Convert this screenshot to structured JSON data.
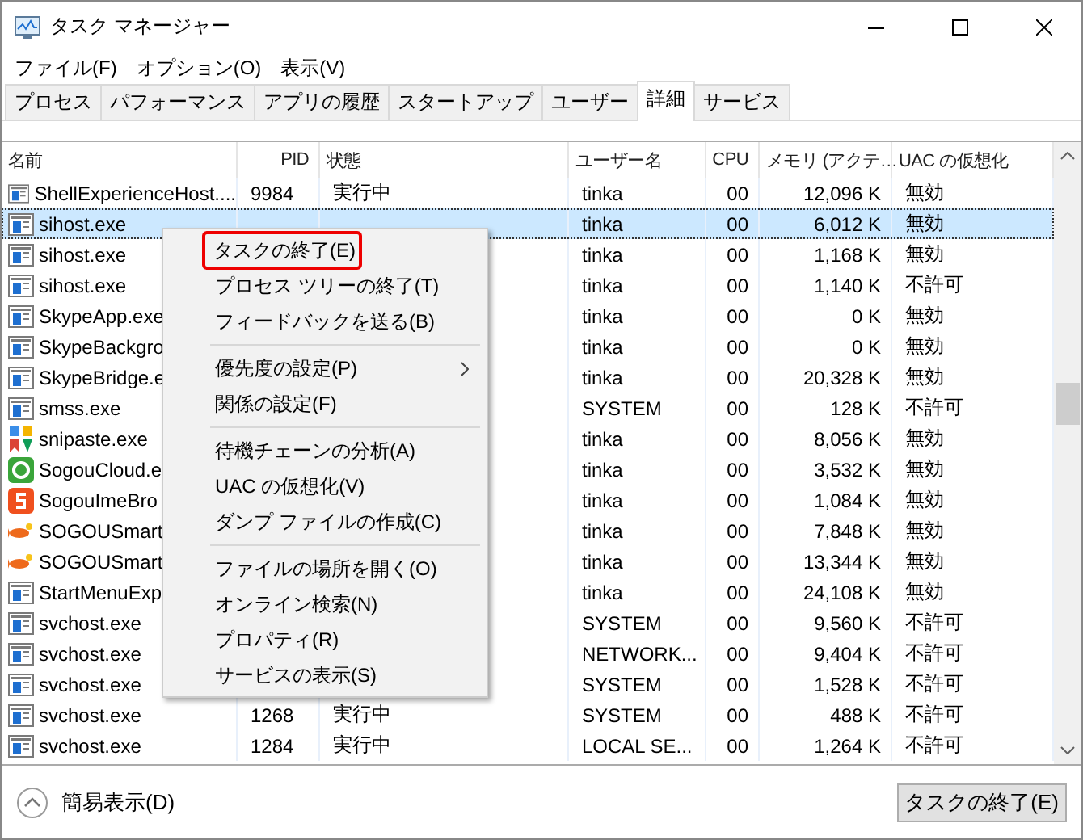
{
  "window": {
    "title": "タスク マネージャー"
  },
  "menu_bar": [
    "ファイル(F)",
    "オプション(O)",
    "表示(V)"
  ],
  "tabs": [
    {
      "label": "プロセス",
      "selected": false
    },
    {
      "label": "パフォーマンス",
      "selected": false
    },
    {
      "label": "アプリの履歴",
      "selected": false
    },
    {
      "label": "スタートアップ",
      "selected": false
    },
    {
      "label": "ユーザー",
      "selected": false
    },
    {
      "label": "詳細",
      "selected": true
    },
    {
      "label": "サービス",
      "selected": false
    }
  ],
  "table": {
    "columns": [
      "名前",
      "PID",
      "状態",
      "ユーザー名",
      "CPU",
      "メモリ (アクテ…",
      "UAC の仮想化"
    ],
    "rows": [
      {
        "kind": "window",
        "name": "ShellExperienceHost....",
        "pid": "9984",
        "status": "実行中",
        "user": "tinka",
        "cpu": "00",
        "memory": "12,096 K",
        "uac": "無効",
        "selected": false
      },
      {
        "kind": "window",
        "name": "sihost.exe",
        "user": "tinka",
        "cpu": "00",
        "memory": "6,012 K",
        "uac": "無効",
        "selected": true
      },
      {
        "kind": "window",
        "name": "sihost.exe",
        "user": "tinka",
        "cpu": "00",
        "memory": "1,168 K",
        "uac": "無効",
        "selected": false
      },
      {
        "kind": "window",
        "name": "sihost.exe",
        "user": "tinka",
        "cpu": "00",
        "memory": "1,140 K",
        "uac": "不許可",
        "selected": false
      },
      {
        "kind": "window",
        "name": "SkypeApp.exe",
        "user": "tinka",
        "cpu": "00",
        "memory": "0 K",
        "uac": "無効",
        "selected": false
      },
      {
        "kind": "window",
        "name": "SkypeBackgro",
        "user": "tinka",
        "cpu": "00",
        "memory": "0 K",
        "uac": "無効",
        "selected": false
      },
      {
        "kind": "window",
        "name": "SkypeBridge.e",
        "user": "tinka",
        "cpu": "00",
        "memory": "20,328 K",
        "uac": "無効",
        "selected": false
      },
      {
        "kind": "window",
        "name": "smss.exe",
        "user": "SYSTEM",
        "cpu": "00",
        "memory": "128 K",
        "uac": "不許可",
        "selected": false
      },
      {
        "kind": "tiles",
        "name": "snipaste.exe",
        "user": "tinka",
        "cpu": "00",
        "memory": "8,056 K",
        "uac": "無効",
        "selected": false
      },
      {
        "kind": "cloud",
        "name": "SogouCloud.e",
        "user": "tinka",
        "cpu": "00",
        "memory": "3,532 K",
        "uac": "無効",
        "selected": false
      },
      {
        "kind": "ime",
        "name": "SogouImeBro",
        "user": "tinka",
        "cpu": "00",
        "memory": "1,084 K",
        "uac": "無効",
        "selected": false
      },
      {
        "kind": "fish",
        "name": "SOGOUSmart",
        "user": "tinka",
        "cpu": "00",
        "memory": "7,848 K",
        "uac": "無効",
        "selected": false
      },
      {
        "kind": "fish",
        "name": "SOGOUSmart",
        "user": "tinka",
        "cpu": "00",
        "memory": "13,344 K",
        "uac": "無効",
        "selected": false
      },
      {
        "kind": "window",
        "name": "StartMenuExp",
        "user": "tinka",
        "cpu": "00",
        "memory": "24,108 K",
        "uac": "無効",
        "selected": false
      },
      {
        "kind": "window",
        "name": "svchost.exe",
        "user": "SYSTEM",
        "cpu": "00",
        "memory": "9,560 K",
        "uac": "不許可",
        "selected": false
      },
      {
        "kind": "window",
        "name": "svchost.exe",
        "user": "NETWORK...",
        "cpu": "00",
        "memory": "9,404 K",
        "uac": "不許可",
        "selected": false
      },
      {
        "kind": "window",
        "name": "svchost.exe",
        "user": "SYSTEM",
        "cpu": "00",
        "memory": "1,528 K",
        "uac": "不許可",
        "selected": false
      },
      {
        "kind": "window",
        "name": "svchost.exe",
        "pid": "1268",
        "status": "実行中",
        "user": "SYSTEM",
        "cpu": "00",
        "memory": "488 K",
        "uac": "不許可",
        "selected": false
      },
      {
        "kind": "window",
        "name": "svchost.exe",
        "pid": "1284",
        "status": "実行中",
        "user": "LOCAL SE...",
        "cpu": "00",
        "memory": "1,264 K",
        "uac": "不許可",
        "selected": false
      }
    ]
  },
  "context_menu": [
    {
      "kind": "item",
      "label": "タスクの終了(E)",
      "highlighted": true,
      "submenu": false
    },
    {
      "kind": "item",
      "label": "プロセス ツリーの終了(T)",
      "highlighted": false,
      "submenu": false
    },
    {
      "kind": "item",
      "label": "フィードバックを送る(B)",
      "highlighted": false,
      "submenu": false
    },
    {
      "kind": "separator"
    },
    {
      "kind": "item",
      "label": "優先度の設定(P)",
      "highlighted": false,
      "submenu": true
    },
    {
      "kind": "item",
      "label": "関係の設定(F)",
      "highlighted": false,
      "submenu": false
    },
    {
      "kind": "separator"
    },
    {
      "kind": "item",
      "label": "待機チェーンの分析(A)",
      "highlighted": false,
      "submenu": false
    },
    {
      "kind": "item",
      "label": "UAC の仮想化(V)",
      "highlighted": false,
      "submenu": false
    },
    {
      "kind": "item",
      "label": "ダンプ ファイルの作成(C)",
      "highlighted": false,
      "submenu": false
    },
    {
      "kind": "separator"
    },
    {
      "kind": "item",
      "label": "ファイルの場所を開く(O)",
      "highlighted": false,
      "submenu": false
    },
    {
      "kind": "item",
      "label": "オンライン検索(N)",
      "highlighted": false,
      "submenu": false
    },
    {
      "kind": "item",
      "label": "プロパティ(R)",
      "highlighted": false,
      "submenu": false
    },
    {
      "kind": "item",
      "label": "サービスの表示(S)",
      "highlighted": false,
      "submenu": false
    }
  ],
  "footer": {
    "fewer_details": "簡易表示(D)",
    "end_task_button": "タスクの終了(E)"
  }
}
